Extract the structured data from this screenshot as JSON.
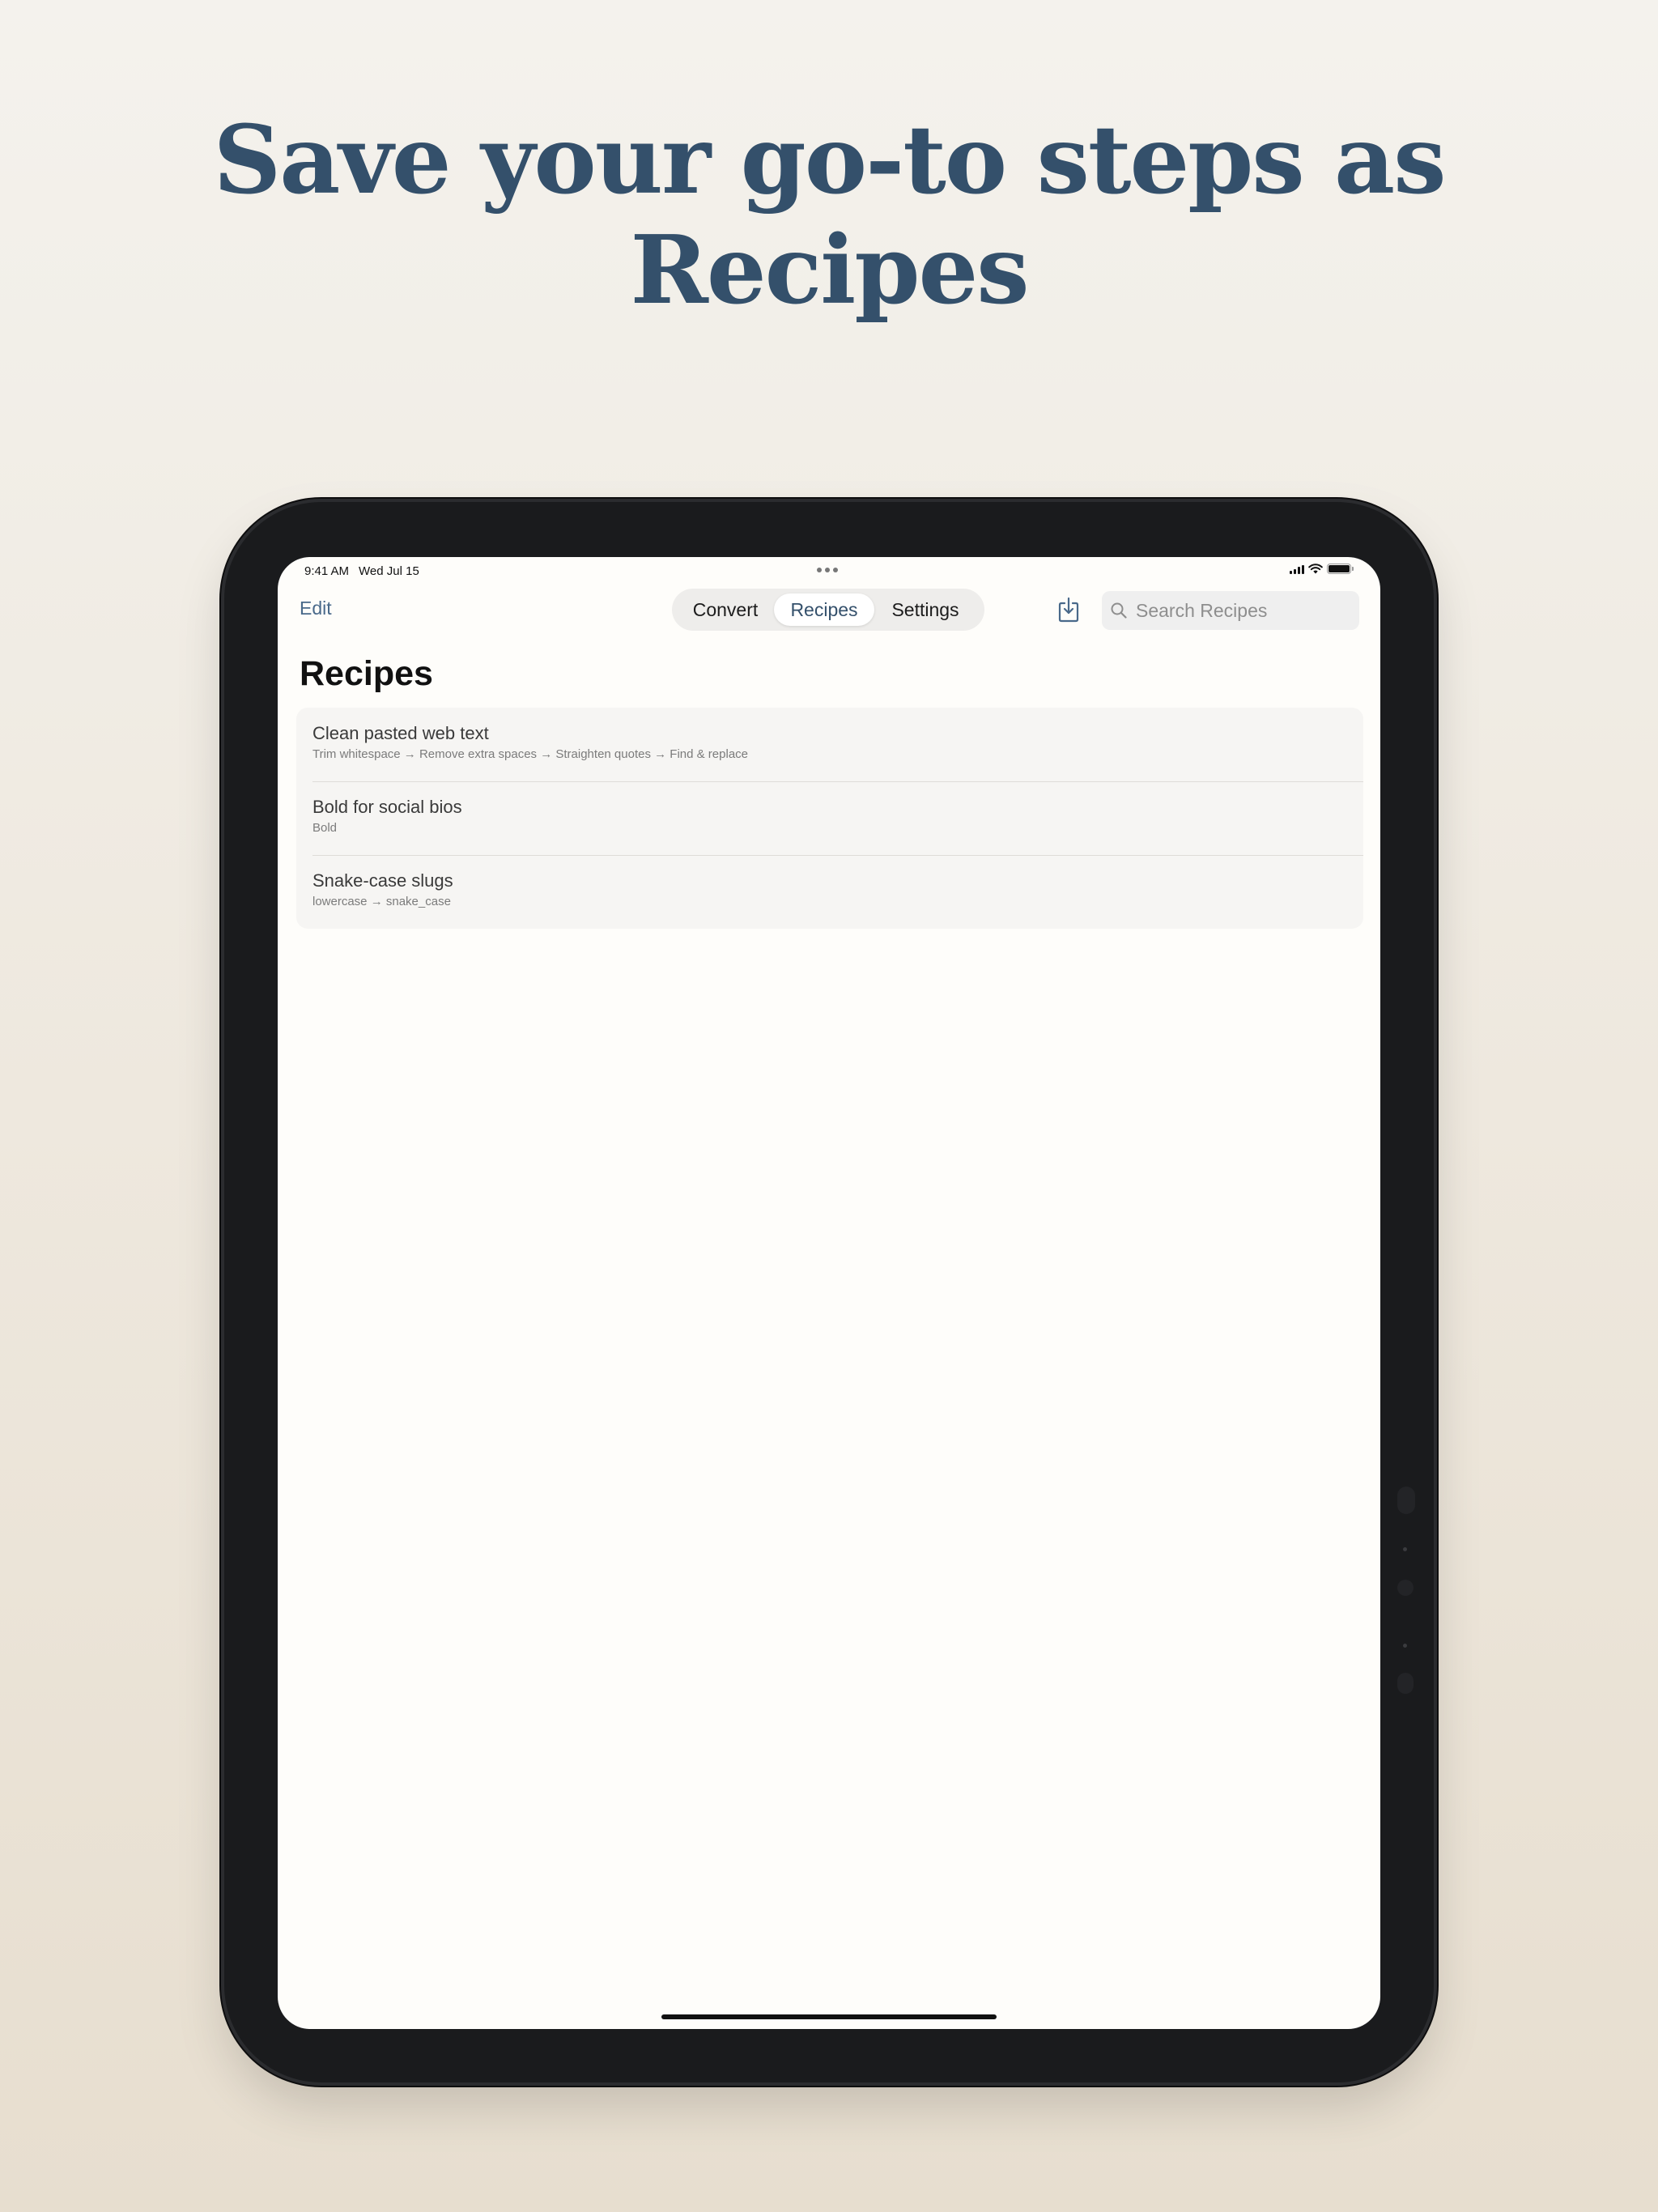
{
  "headline": {
    "line1": "Save your go-to steps as",
    "line2": "Recipes"
  },
  "colors": {
    "headline": "#34506b",
    "accent": "#49698a",
    "background_top": "#f4f2ed",
    "background_bottom": "#e7decf",
    "device": "#1a1b1d"
  },
  "status_bar": {
    "time": "9:41 AM",
    "date": "Wed Jul 15",
    "battery_level": 1.0
  },
  "nav": {
    "edit_label": "Edit",
    "tabs": [
      {
        "label": "Convert",
        "selected": false
      },
      {
        "label": "Recipes",
        "selected": true
      },
      {
        "label": "Settings",
        "selected": false
      }
    ],
    "import_icon": "tray-arrow-down-icon",
    "search_placeholder": "Search Recipes",
    "search_value": ""
  },
  "page": {
    "title": "Recipes"
  },
  "recipes": [
    {
      "title": "Clean pasted web text",
      "steps": "Trim whitespace → Remove extra spaces → Straighten quotes → Find & replace"
    },
    {
      "title": "Bold for social bios",
      "steps": "Bold"
    },
    {
      "title": "Snake-case slugs",
      "steps": "lowercase → snake_case"
    }
  ]
}
